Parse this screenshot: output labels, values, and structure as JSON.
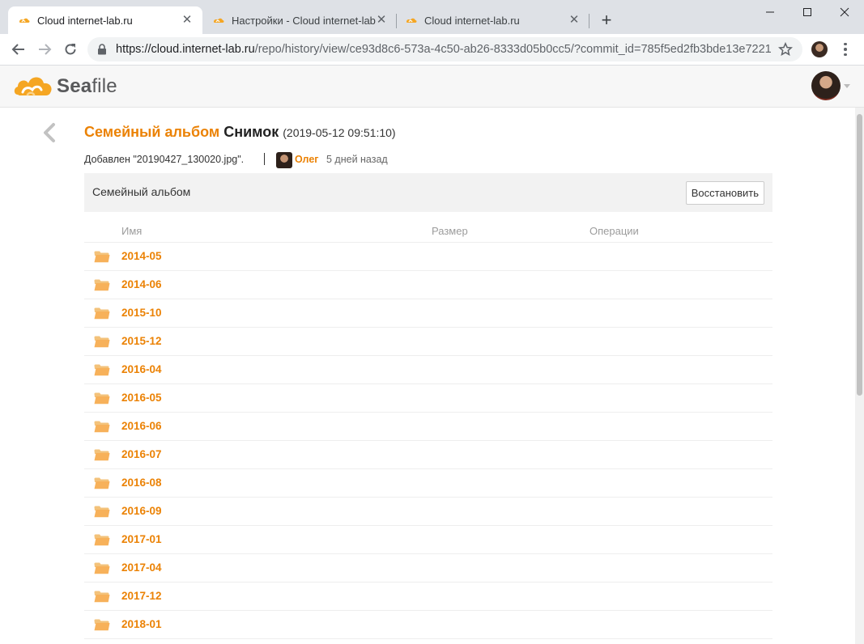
{
  "browser": {
    "tabs": [
      {
        "title": "Cloud internet-lab.ru",
        "active": true
      },
      {
        "title": "Настройки - Cloud internet-lab.ru",
        "active": false
      },
      {
        "title": "Cloud internet-lab.ru",
        "active": false
      }
    ],
    "url_host": "https://cloud.internet-lab.ru",
    "url_path": "/repo/history/view/ce93d8c6-573a-4c50-ab26-8333d05b0cc5/?commit_id=785f5ed2fb3bde13e7221..."
  },
  "header": {
    "logo_text_orange": "Sea",
    "logo_text_grey": "file",
    "brand_color": "#eb8205"
  },
  "snapshot": {
    "library_name": "Семейный альбом",
    "snapshot_label": "Снимок",
    "datetime": "(2019-05-12 09:51:10)",
    "commit_description": "Добавлен \"20190427_130020.jpg\".",
    "author": "Олег",
    "relative_time": "5 дней назад"
  },
  "path_bar": {
    "current_path": "Семейный альбом",
    "restore_label": "Восстановить"
  },
  "table": {
    "columns": {
      "name": "Имя",
      "size": "Размер",
      "operations": "Операции"
    },
    "rows": [
      {
        "name": "2014-05"
      },
      {
        "name": "2014-06"
      },
      {
        "name": "2015-10"
      },
      {
        "name": "2015-12"
      },
      {
        "name": "2016-04"
      },
      {
        "name": "2016-05"
      },
      {
        "name": "2016-06"
      },
      {
        "name": "2016-07"
      },
      {
        "name": "2016-08"
      },
      {
        "name": "2016-09"
      },
      {
        "name": "2017-01"
      },
      {
        "name": "2017-04"
      },
      {
        "name": "2017-12"
      },
      {
        "name": "2018-01"
      }
    ]
  }
}
